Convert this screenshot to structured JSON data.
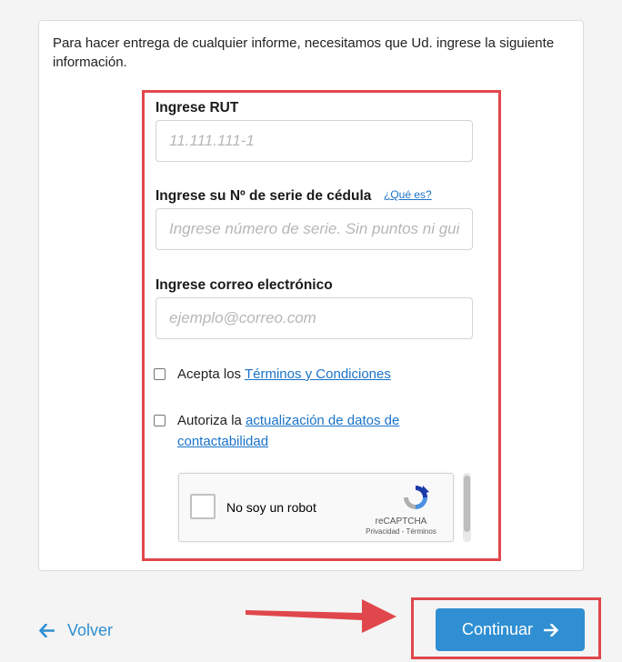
{
  "intro_text": "Para hacer entrega de cualquier informe, necesitamos que Ud. ingrese la siguiente información.",
  "form": {
    "rut": {
      "label": "Ingrese RUT",
      "placeholder": "11.111.111-1",
      "value": ""
    },
    "serie": {
      "label": "Ingrese su Nº de serie de cédula",
      "help_link": "¿Qué es?",
      "placeholder": "Ingrese número de serie. Sin puntos ni guiones",
      "value": ""
    },
    "email": {
      "label": "Ingrese correo electrónico",
      "placeholder": "ejemplo@correo.com",
      "value": ""
    },
    "terms": {
      "prefix": "Acepta los ",
      "link": "Términos y Condiciones",
      "checked": false
    },
    "contact": {
      "prefix": "Autoriza la ",
      "link": "actualización de datos de contactabilidad",
      "checked": false
    },
    "captcha": {
      "label": "No soy un robot",
      "brand": "reCAPTCHA",
      "privacy": "Privacidad",
      "separator": " - ",
      "terms": "Términos"
    }
  },
  "actions": {
    "back_label": "Volver",
    "continue_label": "Continuar"
  },
  "colors": {
    "accent": "#2f8fd2",
    "link": "#1a73c8",
    "highlight": "#e0474c"
  }
}
